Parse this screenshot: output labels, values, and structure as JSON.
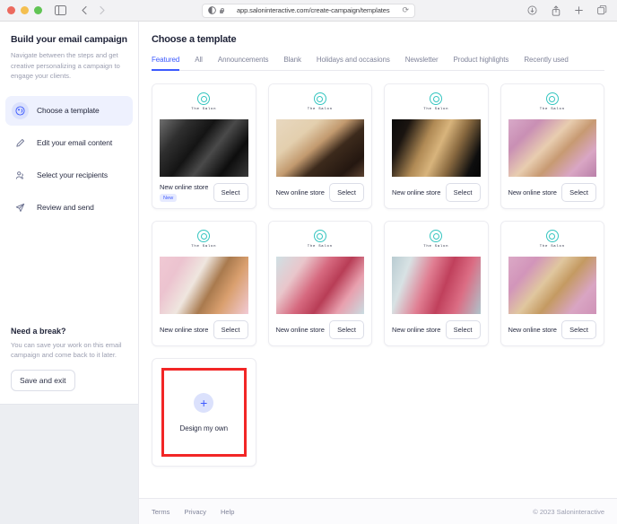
{
  "browser": {
    "url": "app.saloninteractive.com/create-campaign/templates",
    "reload_glyph": "⟳",
    "icons": {
      "sidebar": "sidebar-toggle-icon",
      "back": "back-arrow-icon",
      "forward": "forward-arrow-icon",
      "appearance": "appearance-toggle-icon",
      "downloads": "downloads-icon",
      "share": "share-icon",
      "new_tab": "plus-icon",
      "tabs": "tab-overview-icon"
    }
  },
  "sidebar": {
    "title": "Build your email campaign",
    "description": "Navigate between the steps and get creative personalizing a campaign to engage your clients.",
    "steps": [
      {
        "label": "Choose a template",
        "icon": "palette-icon",
        "active": true
      },
      {
        "label": "Edit your email content",
        "icon": "pencil-icon",
        "active": false
      },
      {
        "label": "Select your recipients",
        "icon": "people-icon",
        "active": false
      },
      {
        "label": "Review and send",
        "icon": "paper-plane-icon",
        "active": false
      }
    ],
    "break": {
      "title": "Need a break?",
      "description": "You can save your work on this email campaign and come back to it later.",
      "button": "Save and exit"
    }
  },
  "main": {
    "page_title": "Choose a template",
    "tabs": [
      {
        "label": "Featured",
        "active": true
      },
      {
        "label": "All",
        "active": false
      },
      {
        "label": "Announcements",
        "active": false
      },
      {
        "label": "Blank",
        "active": false
      },
      {
        "label": "Holidays and occasions",
        "active": false
      },
      {
        "label": "Newsletter",
        "active": false
      },
      {
        "label": "Product highlights",
        "active": false
      },
      {
        "label": "Recently used",
        "active": false
      }
    ],
    "template_logo_text": "The Salon",
    "select_label": "Select",
    "templates": [
      {
        "title": "New online store",
        "badge": "New",
        "photo": "black-and-white-portrait-eye"
      },
      {
        "title": "New online store",
        "badge": "",
        "photo": "woman-dark-curly-hair-beige"
      },
      {
        "title": "New online store",
        "badge": "",
        "photo": "blonde-dreadlocks-on-black"
      },
      {
        "title": "New online store",
        "badge": "",
        "photo": "blonde-waves-pink-background"
      },
      {
        "title": "New online store",
        "badge": "",
        "photo": "back-of-long-hair-pink"
      },
      {
        "title": "New online store",
        "badge": "",
        "photo": "pink-feathered-headpiece"
      },
      {
        "title": "New online store",
        "badge": "",
        "photo": "pink-hair-fan-blue-background"
      },
      {
        "title": "New online store",
        "badge": "",
        "photo": "curly-blonde-pink-wall"
      }
    ],
    "design_own": {
      "label": "Design my own",
      "plus": "+",
      "highlight_color": "#f22626"
    }
  },
  "footer": {
    "links": [
      "Terms",
      "Privacy",
      "Help"
    ],
    "copyright": "© 2023 Saloninteractive"
  },
  "colors": {
    "accent": "#3d5afe",
    "accent_soft": "#eef1fe",
    "brand_teal": "#35c5c0",
    "text_dark": "#1f2338",
    "text_muted": "#9b9eb0",
    "highlight_red": "#f22626"
  }
}
